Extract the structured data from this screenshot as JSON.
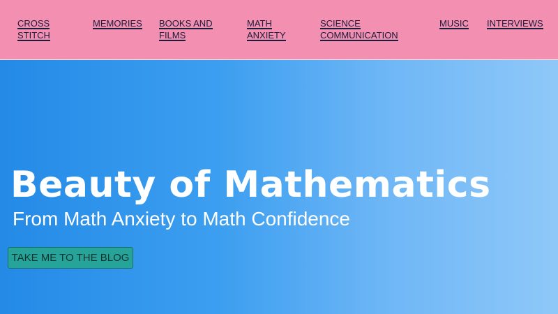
{
  "nav": {
    "items": [
      {
        "lines": [
          "CROSS",
          "STITCH"
        ]
      },
      {
        "lines": [
          "MEMORIES"
        ]
      },
      {
        "lines": [
          "BOOKS AND",
          "FILMS"
        ]
      },
      {
        "lines": [
          "MATH",
          "ANXIETY"
        ]
      },
      {
        "lines": [
          "SCIENCE",
          "COMMUNICATION"
        ]
      },
      {
        "lines": [
          "MUSIC"
        ]
      },
      {
        "lines": [
          "INTERVIEWS"
        ]
      }
    ]
  },
  "hero": {
    "title": "Beauty of Mathematics",
    "subtitle": "From Math Anxiety to Math Confidence",
    "cta_label": "TAKE ME TO THE BLOG"
  },
  "colors": {
    "nav_bg": "#f390b1",
    "hero_gradient_start": "#238ae6",
    "hero_gradient_end": "#8fc8f8",
    "cta_bg": "#27a49a"
  }
}
